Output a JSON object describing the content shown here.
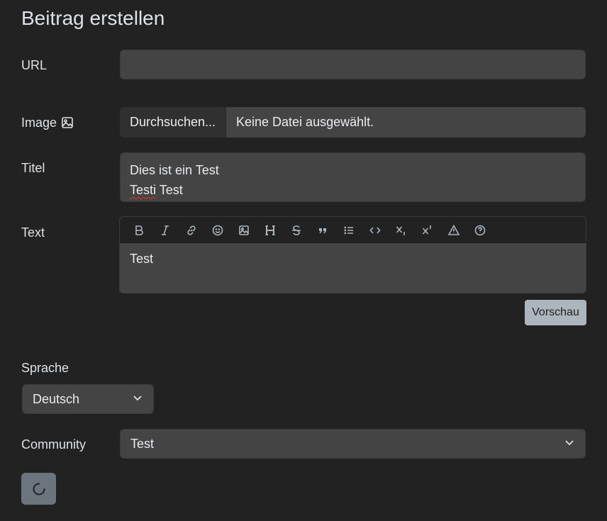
{
  "form": {
    "title": "Beitrag erstellen",
    "url_label": "URL",
    "url_value": "",
    "image_label": "Image",
    "file_button_label": "Durchsuchen...",
    "file_status": "Keine Datei ausgewählt.",
    "title_label": "Titel",
    "title_line1": "Dies ist ein Test",
    "title_line2_word1": "Testi",
    "title_line2_word2": " Test",
    "text_label": "Text",
    "text_value": "Test",
    "preview_button": "Vorschau",
    "language_label": "Sprache",
    "language_selected": "Deutsch",
    "community_label": "Community",
    "community_selected": "Test"
  },
  "toolbar": [
    {
      "name": "bold-icon",
      "glyph": "B"
    },
    {
      "name": "italic-icon",
      "glyph": "I"
    },
    {
      "name": "link-icon"
    },
    {
      "name": "emoji-icon"
    },
    {
      "name": "image-icon"
    },
    {
      "name": "header-icon",
      "glyph": "H"
    },
    {
      "name": "strikethrough-icon",
      "glyph": "S"
    },
    {
      "name": "quote-icon",
      "glyph": "”"
    },
    {
      "name": "list-icon"
    },
    {
      "name": "code-icon"
    },
    {
      "name": "subscript-icon"
    },
    {
      "name": "superscript-icon"
    },
    {
      "name": "warning-icon"
    },
    {
      "name": "help-icon"
    }
  ],
  "colors": {
    "background": "#222222",
    "input": "#444444",
    "preview_button": "#adb5bd",
    "submit_button": "#6c757d"
  }
}
